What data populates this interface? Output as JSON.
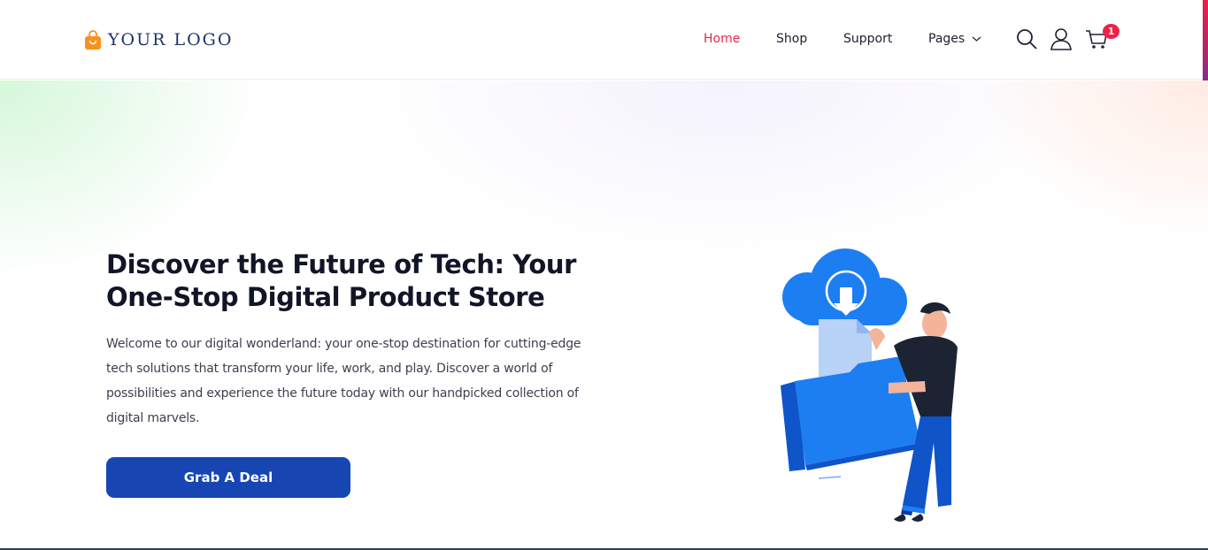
{
  "brand": {
    "logo_text": "YOUR LOGO",
    "color": "#1d3469",
    "bag_color": "#f7921e"
  },
  "nav": {
    "items": [
      {
        "label": "Home",
        "active": true
      },
      {
        "label": "Shop",
        "active": false
      },
      {
        "label": "Support",
        "active": false
      },
      {
        "label": "Pages",
        "active": false,
        "has_dropdown": true
      }
    ],
    "active_color": "#e8284a"
  },
  "header_icons": [
    "search-icon",
    "user-icon",
    "cart-icon"
  ],
  "cart": {
    "count": "1",
    "badge_color": "#f01f47"
  },
  "hero": {
    "title": "Discover the Future of Tech: Your One-Stop Digital Product Store",
    "description": "Welcome to our digital wonderland: your one-stop destination for cutting-edge tech solutions that transform your life, work, and play. Discover a world of possibilities and experience the future today with our handpicked collection of digital marvels.",
    "cta_label": "Grab A Deal",
    "cta_color": "#1746b3",
    "illustration": "person-holding-folder-cloud-download"
  }
}
